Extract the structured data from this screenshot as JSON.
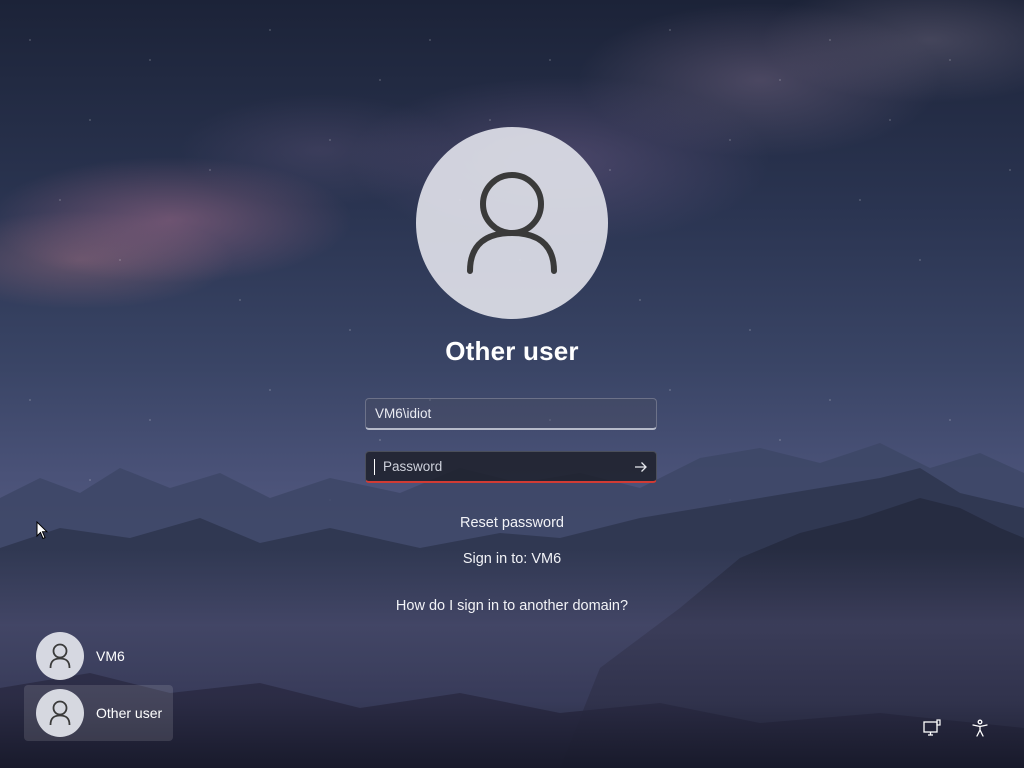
{
  "login": {
    "user_name": "Other user",
    "username_value": "VM6\\idiot",
    "password_placeholder": "Password",
    "reset_password": "Reset password",
    "sign_in_to": "Sign in to: VM6",
    "other_domain": "How do I sign in to another domain?"
  },
  "user_list": [
    {
      "label": "VM6",
      "selected": false
    },
    {
      "label": "Other user",
      "selected": true
    }
  ],
  "icons": {
    "avatar": "user-silhouette-icon",
    "submit": "arrow-right-icon",
    "network": "network-monitor-icon",
    "accessibility": "accessibility-icon"
  },
  "colors": {
    "password_underline": "#d13b34",
    "avatar_bg": "#dee0e8"
  }
}
